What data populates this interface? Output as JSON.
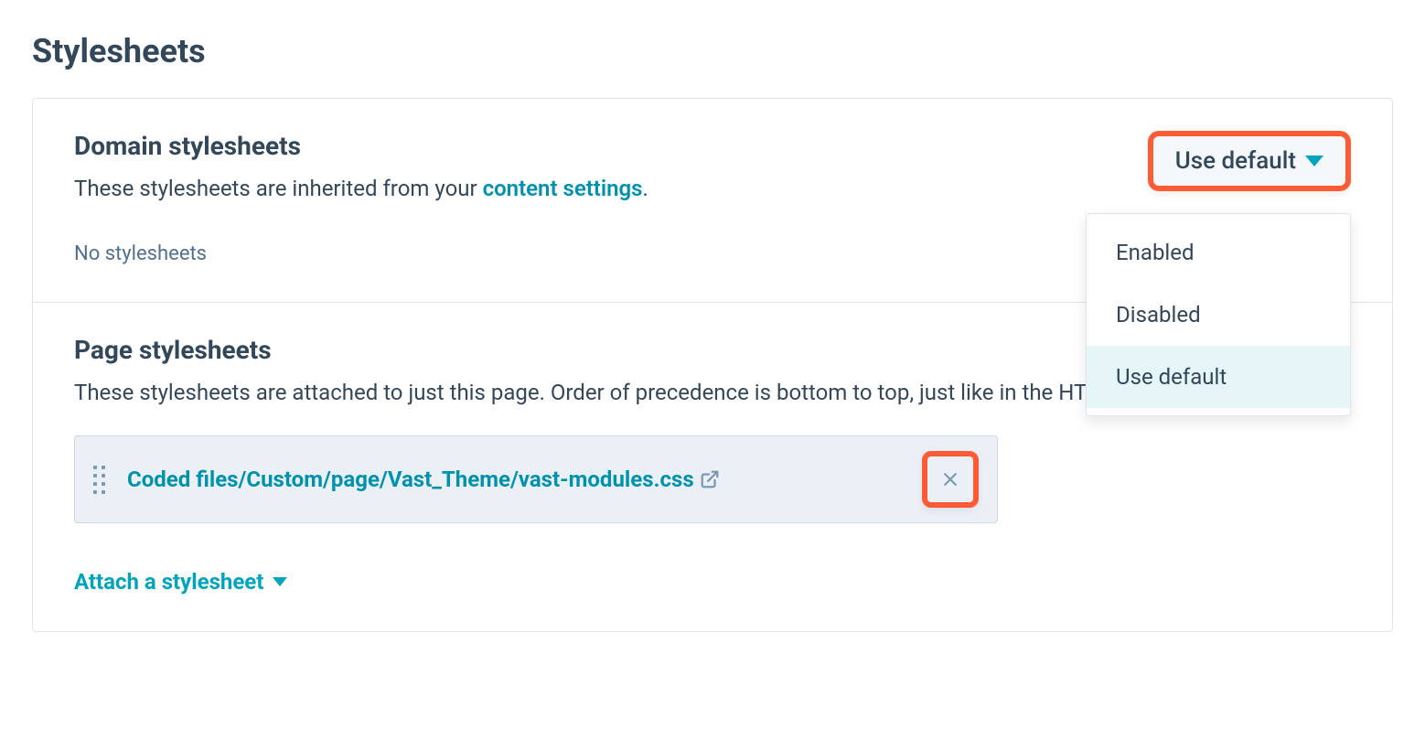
{
  "page_title": "Stylesheets",
  "domain_section": {
    "title": "Domain stylesheets",
    "desc_prefix": "These stylesheets are inherited from your ",
    "desc_link": "content settings",
    "desc_suffix": ".",
    "empty": "No stylesheets",
    "dropdown": {
      "selected": "Use default",
      "options": [
        "Enabled",
        "Disabled",
        "Use default"
      ]
    }
  },
  "page_section": {
    "title": "Page stylesheets",
    "desc": "These stylesheets are attached to just this page. Order of precedence is bottom to top, just like in the HTML.",
    "stylesheet_path": "Coded files/Custom/page/Vast_Theme/vast-modules.css",
    "attach_label": "Attach a stylesheet"
  }
}
